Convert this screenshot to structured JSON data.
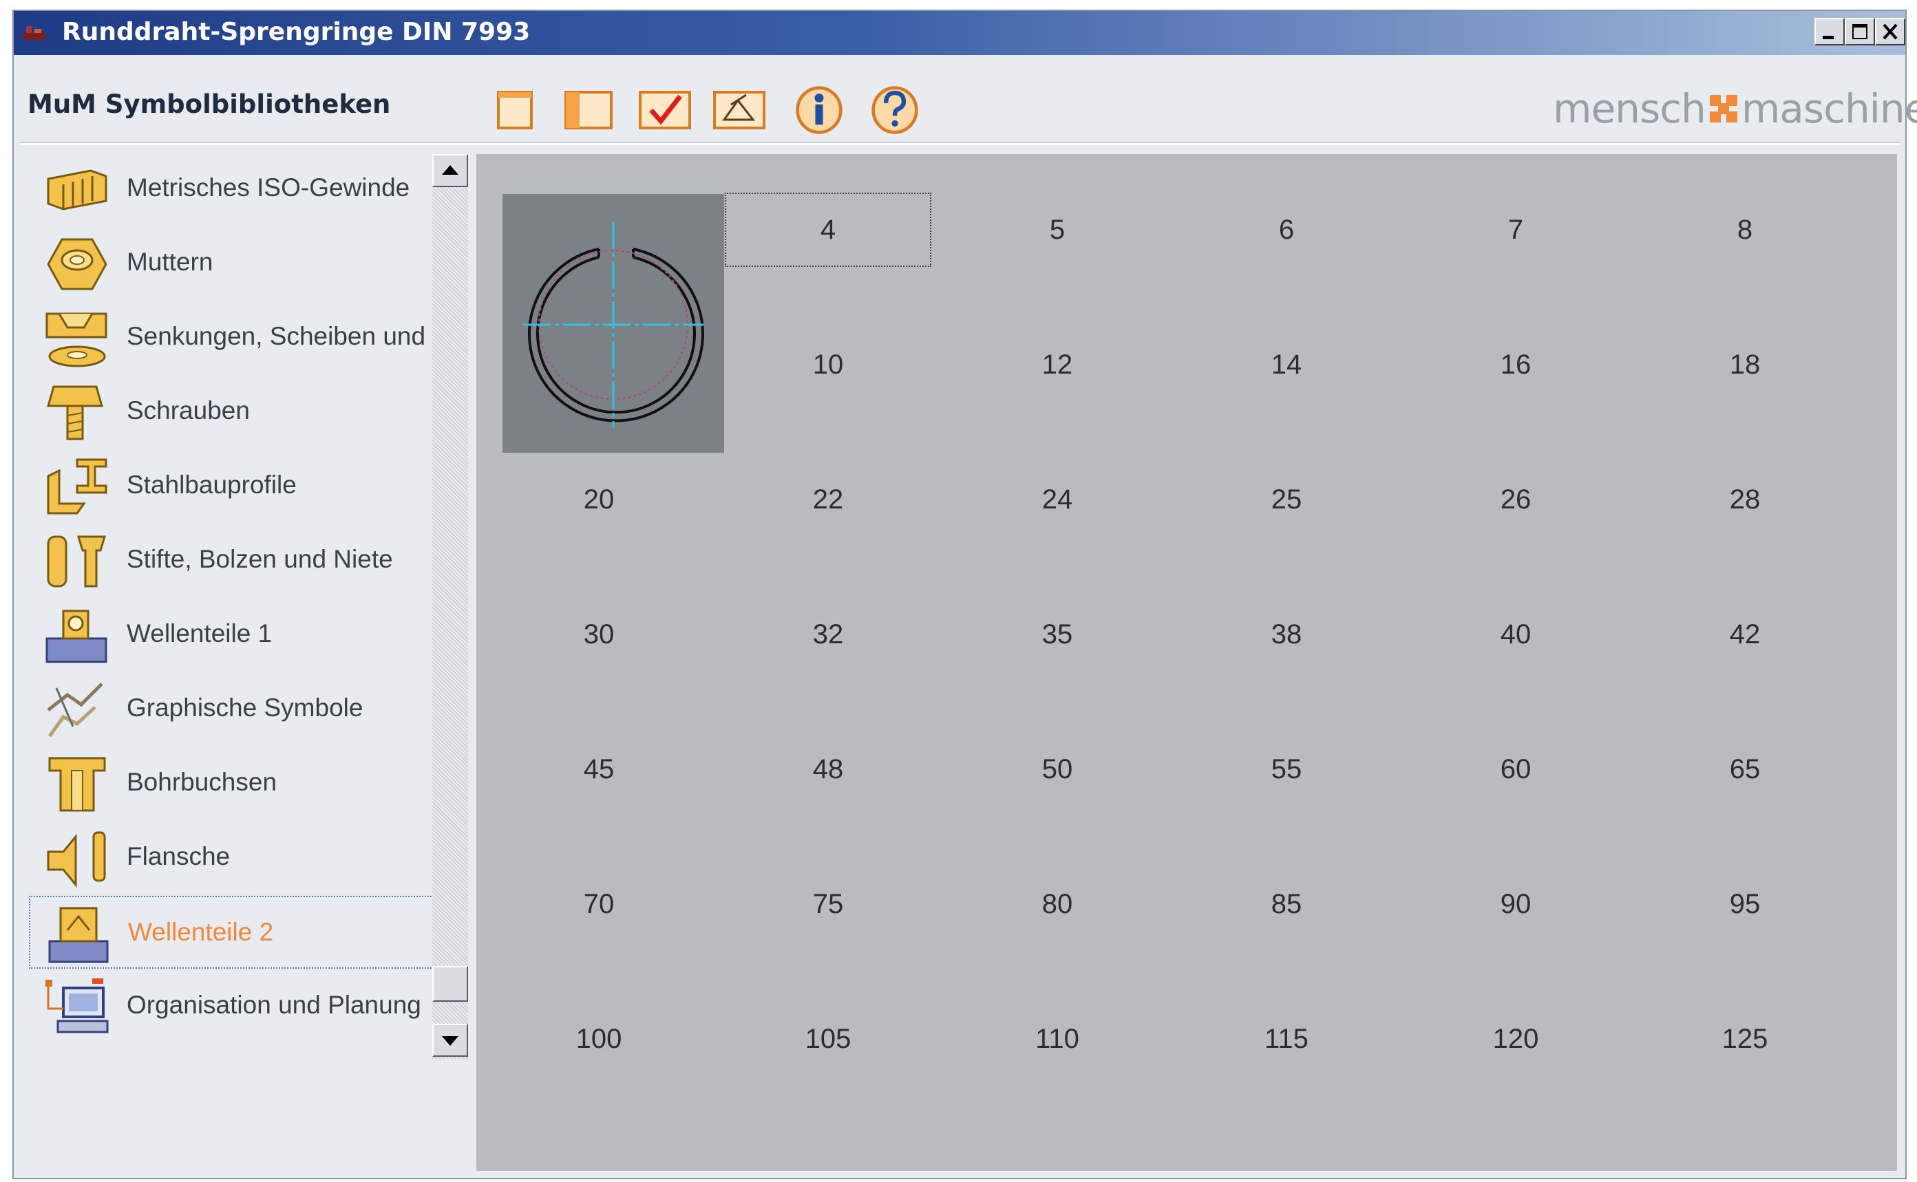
{
  "window": {
    "title": "Runddraht-Sprengringe DIN 7993"
  },
  "header": {
    "library_title": "MuM Symbolbibliotheken",
    "toolbar": [
      {
        "icon": "blank-page-icon"
      },
      {
        "icon": "panel-page-icon"
      },
      {
        "icon": "checkmark-icon"
      },
      {
        "icon": "measure-icon"
      },
      {
        "icon": "info-icon"
      },
      {
        "icon": "help-icon"
      }
    ],
    "logo": {
      "left": "mensch",
      "right": "maschine",
      "accent_color": "#f08a3a"
    }
  },
  "sidebar": {
    "items": [
      {
        "label": "Metrisches ISO-Gewinde",
        "icon": "thread-icon"
      },
      {
        "label": "Muttern",
        "icon": "nut-icon"
      },
      {
        "label": "Senkungen, Scheiben und Du",
        "icon": "washer-icon"
      },
      {
        "label": "Schrauben",
        "icon": "screw-icon"
      },
      {
        "label": "Stahlbauprofile",
        "icon": "steel-profile-icon"
      },
      {
        "label": "Stifte, Bolzen und Niete",
        "icon": "pin-bolt-icon"
      },
      {
        "label": "Wellenteile 1",
        "icon": "shaft-part-icon"
      },
      {
        "label": "Graphische Symbole",
        "icon": "graphic-symbol-icon"
      },
      {
        "label": "Bohrbuchsen",
        "icon": "drill-bushing-icon"
      },
      {
        "label": "Flansche",
        "icon": "flange-icon"
      },
      {
        "label": "Wellenteile 2",
        "icon": "shaft-part-2-icon",
        "selected": true
      },
      {
        "label": "Organisation und Planung",
        "icon": "computer-icon"
      }
    ]
  },
  "sizes": {
    "rows": [
      [
        "4",
        "5",
        "6",
        "7",
        "8"
      ],
      [
        "10",
        "12",
        "14",
        "16",
        "18"
      ],
      [
        "20",
        "22",
        "24",
        "25",
        "26",
        "28"
      ],
      [
        "30",
        "32",
        "35",
        "38",
        "40",
        "42"
      ],
      [
        "45",
        "48",
        "50",
        "55",
        "60",
        "65"
      ],
      [
        "70",
        "75",
        "80",
        "85",
        "90",
        "95"
      ],
      [
        "100",
        "105",
        "110",
        "115",
        "120",
        "125"
      ]
    ],
    "selected": "4"
  },
  "colors": {
    "title_bar_start": "#1e3c85",
    "content_background": "#b8bcc1",
    "selected_label": "#f08a3a"
  }
}
